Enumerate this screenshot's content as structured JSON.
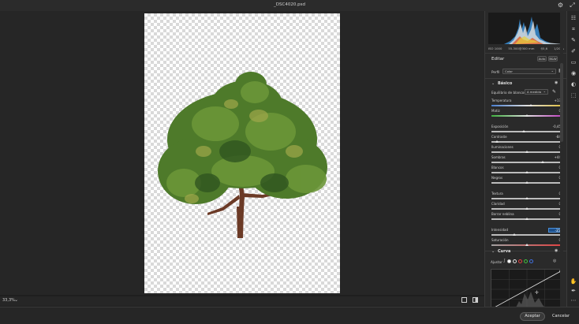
{
  "window": {
    "title": "_DSC4020.psd"
  },
  "status": {
    "zoom": "33,3%"
  },
  "actions": {
    "accept": "Aceptar",
    "cancel": "Cancelar"
  },
  "camera": {
    "iso": "ISO 1000",
    "lens": "55-300@300 mm",
    "aperture": "f/5,6",
    "shutter": "1/200s"
  },
  "edit": {
    "title": "Editar",
    "auto": "Auto",
    "bw": "B&W",
    "profile_label": "Perfil",
    "profile_value": "Color",
    "basic_title": "Básico",
    "wb_label": "Equilibrio de blancos",
    "wb_value": "A medida",
    "sliders": [
      {
        "label": "Temperatura",
        "value": "+17",
        "pos": 0.55
      },
      {
        "label": "Matiz",
        "value": "0",
        "pos": 0.5
      },
      {
        "label": "Exposición",
        "value": "-0,45",
        "pos": 0.45
      },
      {
        "label": "Contraste",
        "value": "-84",
        "pos": 0.08
      },
      {
        "label": "Iluminaciones",
        "value": "0",
        "pos": 0.5
      },
      {
        "label": "Sombras",
        "value": "+44",
        "pos": 0.72
      },
      {
        "label": "Blancos",
        "value": "0",
        "pos": 0.5
      },
      {
        "label": "Negros",
        "value": "0",
        "pos": 0.5
      },
      {
        "label": "Textura",
        "value": "0",
        "pos": 0.5
      },
      {
        "label": "Claridad",
        "value": "0",
        "pos": 0.5
      },
      {
        "label": "Borrar neblina",
        "value": "0",
        "pos": 0.5
      },
      {
        "label": "Intensidad",
        "value": "-35",
        "pos": 0.32
      },
      {
        "label": "Saturación",
        "value": "0",
        "pos": 0.5
      }
    ],
    "curve_title": "Curva",
    "adjust_label": "Ajustar"
  },
  "colors": {
    "canvas_bg": "#262626",
    "panel_bg": "#2a2a2a",
    "active_value": "#1c4f8a"
  },
  "icons": {
    "gear": "gear-icon",
    "edit": "sliders-icon",
    "crop": "crop-icon",
    "heal": "heal-icon",
    "mask": "mask-icon",
    "redeye": "redeye-icon",
    "presets": "presets-icon",
    "more": "more-icon"
  }
}
